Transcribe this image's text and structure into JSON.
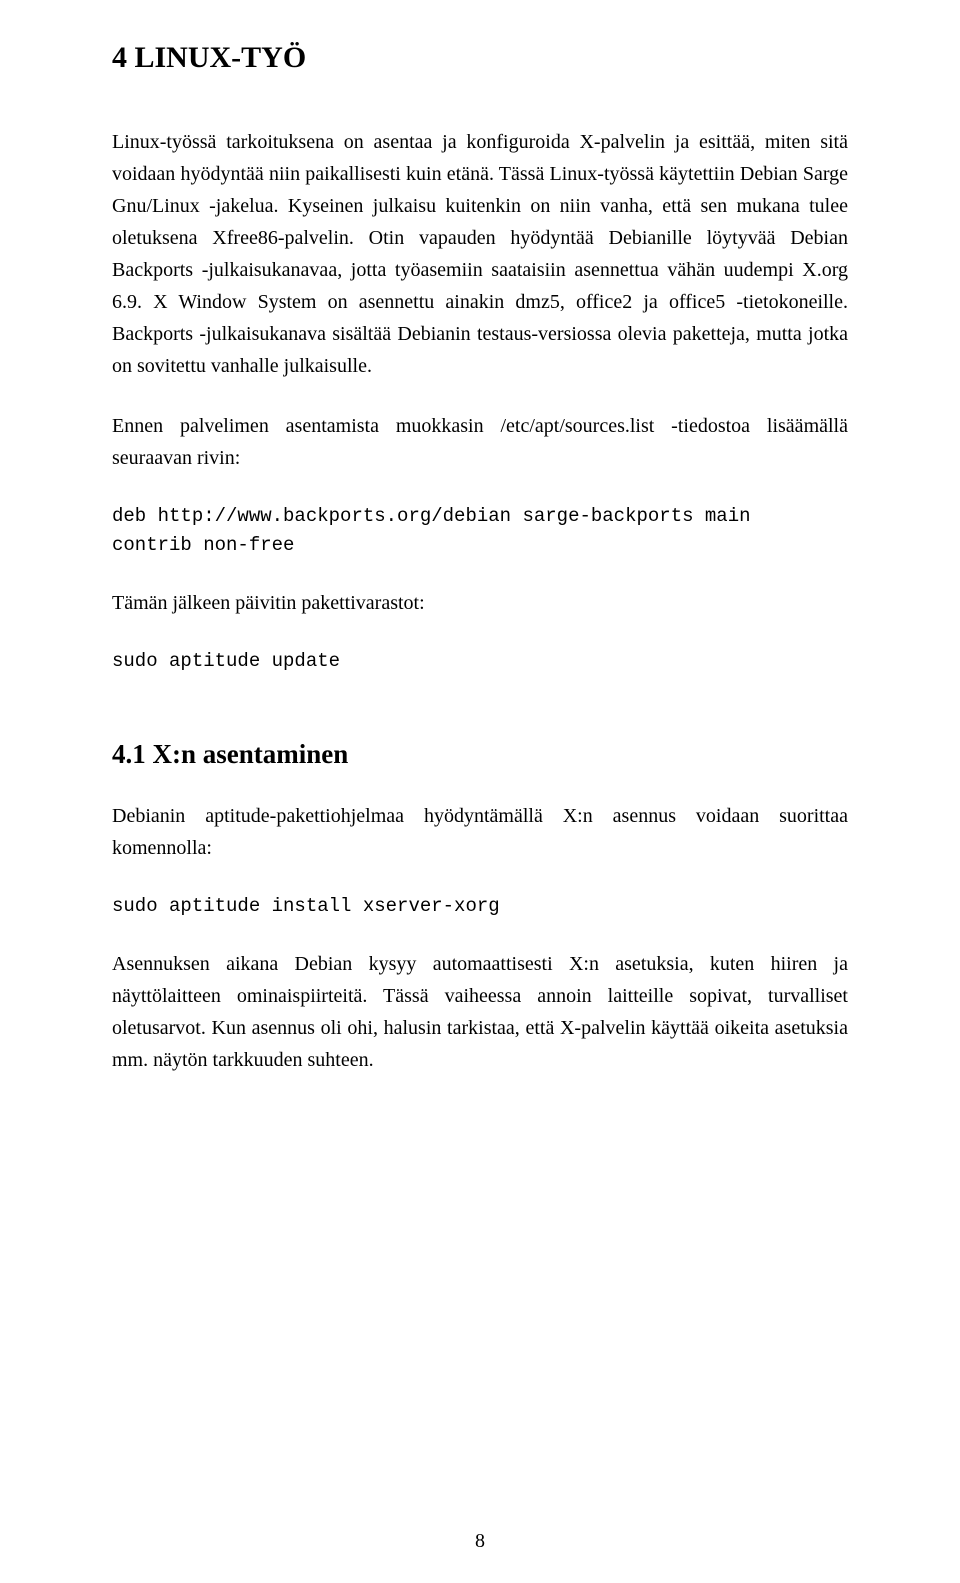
{
  "section": {
    "number": "4",
    "title": "LINUX-TYÖ",
    "heading": "4  LINUX-TYÖ"
  },
  "paragraphs": {
    "p1": "Linux-työssä tarkoituksena on asentaa ja konfiguroida X-palvelin ja esittää, miten sitä voidaan hyödyntää niin paikallisesti kuin etänä. Tässä Linux-työssä käytettiin Debian Sarge Gnu/Linux -jakelua. Kyseinen julkaisu kuitenkin on niin vanha, että sen mukana tulee oletuksena Xfree86-palvelin. Otin vapauden hyödyntää Debianille löytyvää Debian Backports -julkaisukanavaa, jotta työasemiin saataisiin asennettua vähän uudempi X.org 6.9. X Window System on asennettu ainakin dmz5, office2 ja office5 -tietokoneille. Backports -julkaisukanava sisältää Debianin testaus-versiossa olevia paketteja, mutta jotka on sovitettu vanhalle julkaisulle.",
    "p2": "Ennen palvelimen asentamista muokkasin /etc/apt/sources.list -tiedostoa lisäämällä seuraavan rivin:",
    "code1": "deb http://www.backports.org/debian sarge-backports main\ncontrib non-free",
    "p3": "Tämän jälkeen päivitin pakettivarastot:",
    "code2": "sudo aptitude update"
  },
  "subsection": {
    "number": "4.1",
    "title": "X:n asentaminen",
    "heading": "4.1   X:n asentaminen"
  },
  "subparagraphs": {
    "p1": "Debianin aptitude-pakettiohjelmaa hyödyntämällä X:n asennus voidaan suorittaa komennolla:",
    "code1": "sudo aptitude install xserver-xorg",
    "p2": "Asennuksen aikana Debian kysyy automaattisesti X:n asetuksia, kuten hiiren ja näyttölaitteen ominaispiirteitä. Tässä vaiheessa annoin laitteille sopivat, turvalliset oletusarvot. Kun asennus oli ohi, halusin tarkistaa, että X-palvelin käyttää oikeita asetuksia mm. näytön tarkkuuden suhteen."
  },
  "pageNumber": "8"
}
